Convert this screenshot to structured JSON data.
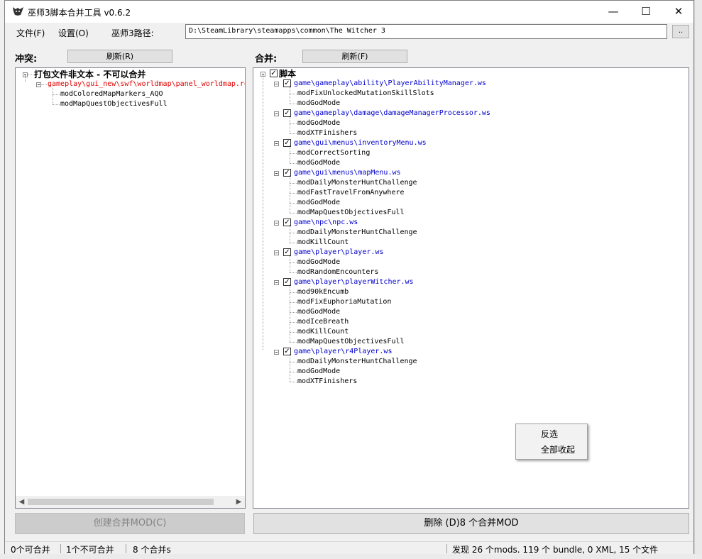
{
  "window": {
    "title": "巫师3脚本合并工具 v0.6.2",
    "minimize": "—",
    "maximize": "☐",
    "close": "✕"
  },
  "menu": {
    "file": "文件(F)",
    "settings": "设置(O)",
    "path_label": "巫师3路径:",
    "path_value": "D:\\SteamLibrary\\steamapps\\common\\The Witcher 3",
    "browse": ".."
  },
  "conflicts": {
    "label": "冲突:",
    "refresh": "刷新(R)",
    "root": "打包文件非文本 - 不可以合并",
    "file": "gameplay\\gui_new\\swf\\worldmap\\panel_worldmap.re",
    "mods": [
      "modColoredMapMarkers_AQO",
      "modMapQuestObjectivesFull"
    ]
  },
  "merge": {
    "label": "合并:",
    "refresh": "刷新(F)",
    "root": "脚本",
    "files": [
      {
        "path": "game\\gameplay\\ability\\PlayerAbilityManager.ws",
        "mods": [
          "modFixUnlockedMutationSkillSlots",
          "modGodMode"
        ]
      },
      {
        "path": "game\\gameplay\\damage\\damageManagerProcessor.ws",
        "mods": [
          "modGodMode",
          "modXTFinishers"
        ]
      },
      {
        "path": "game\\gui\\menus\\inventoryMenu.ws",
        "mods": [
          "modCorrectSorting",
          "modGodMode"
        ]
      },
      {
        "path": "game\\gui\\menus\\mapMenu.ws",
        "mods": [
          "modDailyMonsterHuntChallenge",
          "modFastTravelFromAnywhere",
          "modGodMode",
          "modMapQuestObjectivesFull"
        ]
      },
      {
        "path": "game\\npc\\npc.ws",
        "mods": [
          "modDailyMonsterHuntChallenge",
          "modKillCount"
        ]
      },
      {
        "path": "game\\player\\player.ws",
        "mods": [
          "modGodMode",
          "modRandomEncounters"
        ]
      },
      {
        "path": "game\\player\\playerWitcher.ws",
        "mods": [
          "mod90kEncumb",
          "modFixEuphoriaMutation",
          "modGodMode",
          "modIceBreath",
          "modKillCount",
          "modMapQuestObjectivesFull"
        ]
      },
      {
        "path": "game\\player\\r4Player.ws",
        "mods": [
          "modDailyMonsterHuntChallenge",
          "modGodMode",
          "modXTFinishers"
        ]
      }
    ]
  },
  "context_menu": {
    "invert": "反选",
    "collapse_all": "全部收起"
  },
  "buttons": {
    "create": "创建合并MOD(C)",
    "delete": "删除 (D)8 个合并MOD"
  },
  "status": {
    "mergeable": "0个可合并",
    "unmergeable": "1个不可合并",
    "merged": "8 个合并s",
    "found": "发现 26 个mods. 119 个 bundle, 0 XML, 15 个文件"
  },
  "colors": {
    "conflict_file": "#e00000",
    "merge_file": "#0000cc"
  }
}
